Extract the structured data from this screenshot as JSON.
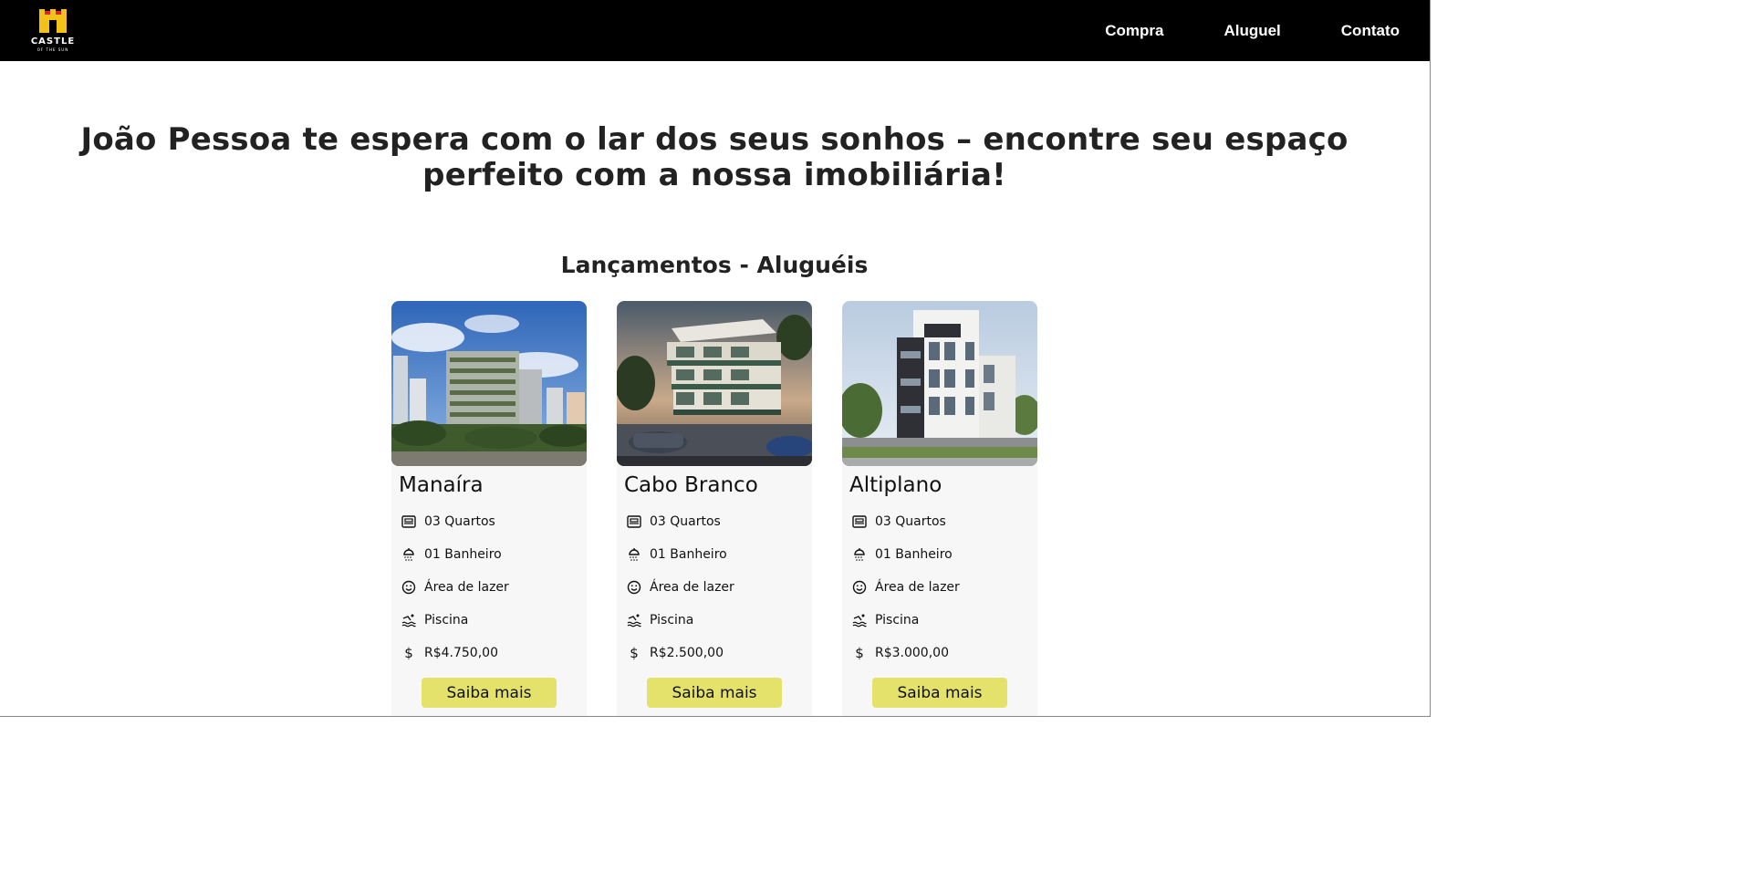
{
  "navbar": {
    "logo_text": "CASTLE",
    "logo_subtext": "OF THE SUN",
    "links": [
      "Compra",
      "Aluguel",
      "Contato"
    ]
  },
  "hero": {
    "title": "João Pessoa te espera com o lar dos seus sonhos – encontre seu espaço perfeito com a nossa imobiliária!"
  },
  "section": {
    "title": "Lançamentos - Aluguéis"
  },
  "cards": [
    {
      "title": "Manaíra",
      "features": {
        "rooms": "03 Quartos",
        "bath": "01 Banheiro",
        "leisure": "Área de lazer",
        "pool": "Piscina",
        "price": "R$4.750,00"
      },
      "button": "Saiba mais"
    },
    {
      "title": "Cabo Branco",
      "features": {
        "rooms": "03 Quartos",
        "bath": "01 Banheiro",
        "leisure": "Área de lazer",
        "pool": "Piscina",
        "price": "R$2.500,00"
      },
      "button": "Saiba mais"
    },
    {
      "title": "Altiplano",
      "features": {
        "rooms": "03 Quartos",
        "bath": "01 Banheiro",
        "leisure": "Área de lazer",
        "pool": "Piscina",
        "price": "R$3.000,00"
      },
      "button": "Saiba mais"
    }
  ],
  "colors": {
    "navbar_bg": "#000000",
    "button_bg": "#e4e26b",
    "card_bg": "#f7f7f7",
    "logo_gold": "#f2c21b",
    "logo_red": "#d9232e"
  },
  "icons": {
    "rooms": "bed-icon",
    "bath": "shower-icon",
    "leisure": "smile-icon",
    "pool": "swim-icon",
    "price": "dollar-icon"
  }
}
